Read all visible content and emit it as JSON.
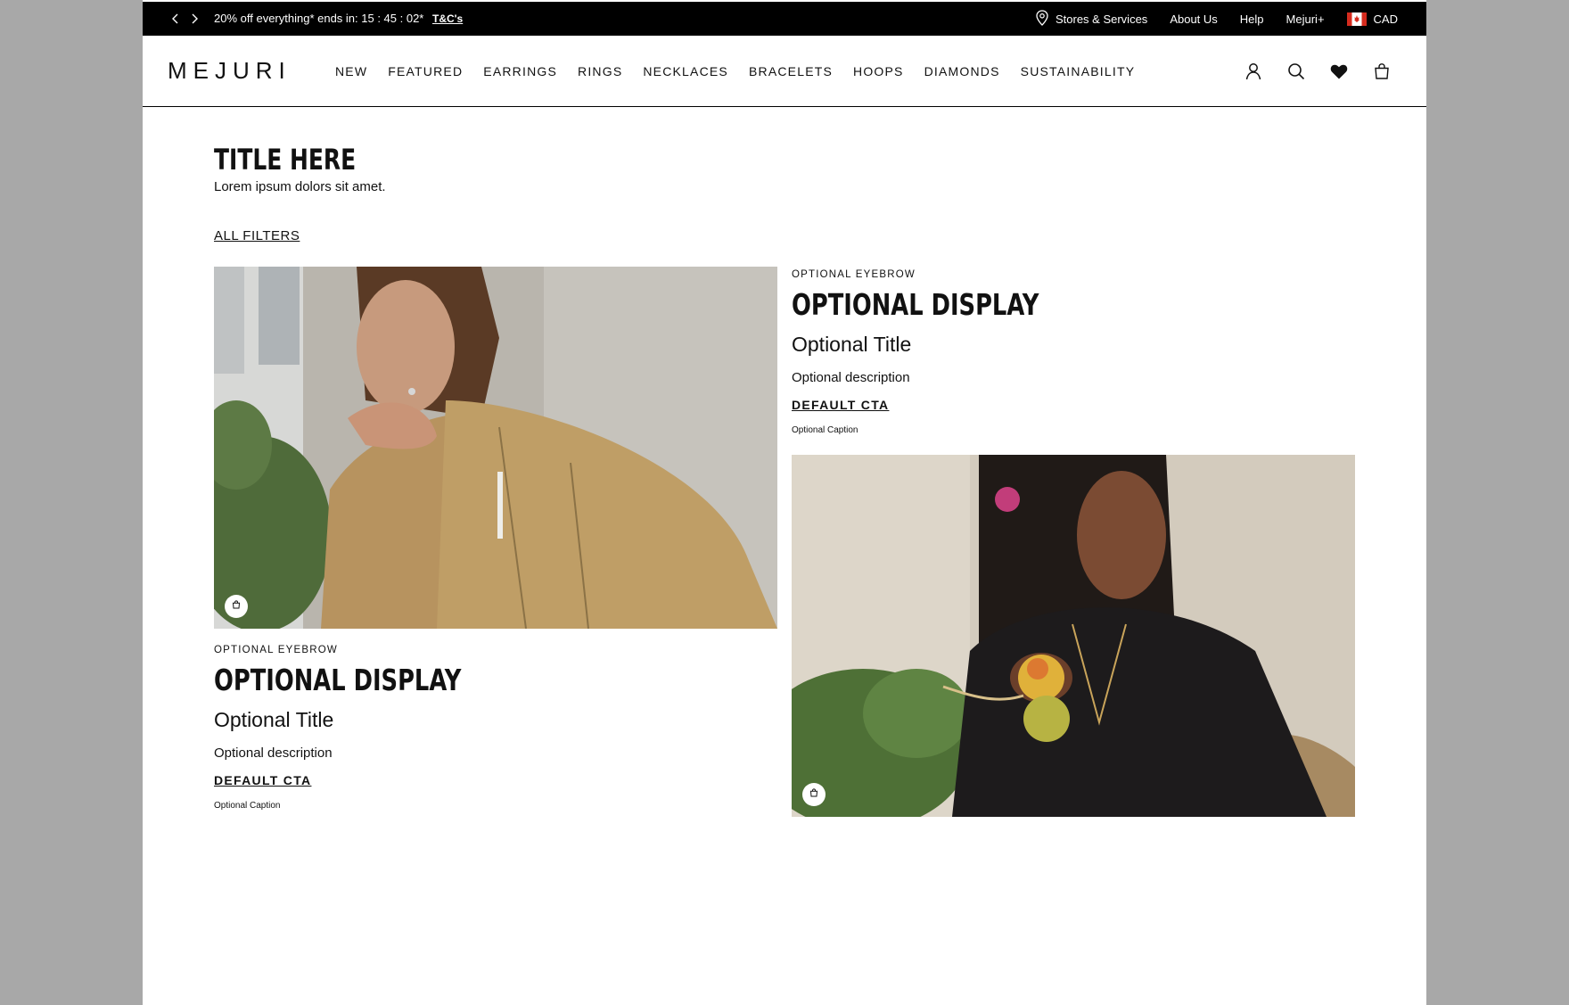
{
  "announcement": {
    "promo_text": "20% off everything* ends in: 15 : 45 : 02*",
    "terms_link": "T&C's",
    "utility_links": {
      "stores": "Stores & Services",
      "about": "About Us",
      "help": "Help",
      "mejuri_plus": "Mejuri+",
      "currency": "CAD"
    }
  },
  "header": {
    "logo": "MEJURI",
    "nav": [
      "NEW",
      "FEATURED",
      "EARRINGS",
      "RINGS",
      "NECKLACES",
      "BRACELETS",
      "HOOPS",
      "DIAMONDS",
      "SUSTAINABILITY"
    ]
  },
  "main": {
    "title": "TITLE HERE",
    "subtitle": "Lorem ipsum dolors sit amet.",
    "filters_link": "ALL FILTERS",
    "cards": [
      {
        "eyebrow": "OPTIONAL EYEBROW",
        "display": "OPTIONAL DISPLAY",
        "title": "Optional Title",
        "description": "Optional description",
        "cta": "DEFAULT CTA",
        "caption": "Optional Caption"
      },
      {
        "eyebrow": "OPTIONAL EYEBROW",
        "display": "OPTIONAL DISPLAY",
        "title": "Optional Title",
        "description": "Optional description",
        "cta": "DEFAULT CTA",
        "caption": "Optional Caption"
      }
    ]
  },
  "colors": {
    "background_outer": "#a8a8a8",
    "announcement_bar": "#000000",
    "text": "#111111"
  }
}
